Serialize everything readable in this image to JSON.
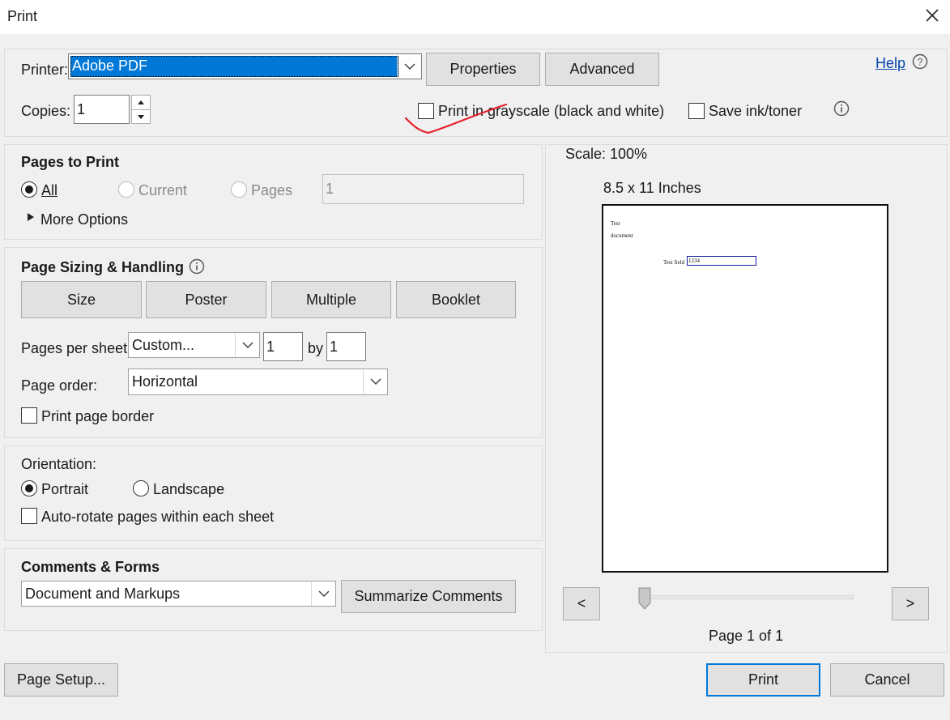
{
  "window": {
    "title": "Print"
  },
  "printer": {
    "label": "Printer:",
    "value": "Adobe PDF",
    "properties": "Properties",
    "advanced": "Advanced",
    "help": "Help",
    "copies_label": "Copies:",
    "copies_value": "1",
    "grayscale_label": "Print in grayscale (black and white)",
    "save_ink_label": "Save ink/toner"
  },
  "pages_to_print": {
    "heading": "Pages to Print",
    "all": "All",
    "current": "Current",
    "pages": "Pages",
    "pages_value": "1",
    "more_options": "More Options"
  },
  "sizing": {
    "heading": "Page Sizing & Handling",
    "size": "Size",
    "poster": "Poster",
    "multiple": "Multiple",
    "booklet": "Booklet",
    "pages_per_sheet_label": "Pages per sheet:",
    "pages_per_sheet_value": "Custom...",
    "cols": "1",
    "by": "by",
    "rows": "1",
    "page_order_label": "Page order:",
    "page_order_value": "Horizontal",
    "print_border": "Print page border"
  },
  "orientation": {
    "heading": "Orientation:",
    "portrait": "Portrait",
    "landscape": "Landscape",
    "auto_rotate": "Auto-rotate pages within each sheet"
  },
  "comments": {
    "heading": "Comments & Forms",
    "value": "Document and Markups",
    "summarize": "Summarize Comments"
  },
  "preview": {
    "scale": "Scale: 100%",
    "size": "8.5 x 11 Inches",
    "doc_line1": "Test",
    "doc_line2": "document",
    "field_label": "Test field",
    "field_value": "1234",
    "prev": "<",
    "next": ">",
    "page_info": "Page 1 of 1"
  },
  "footer": {
    "page_setup": "Page Setup...",
    "print": "Print",
    "cancel": "Cancel"
  },
  "colors": {
    "selection": "#0078d7",
    "annotation": "#e5202a"
  }
}
